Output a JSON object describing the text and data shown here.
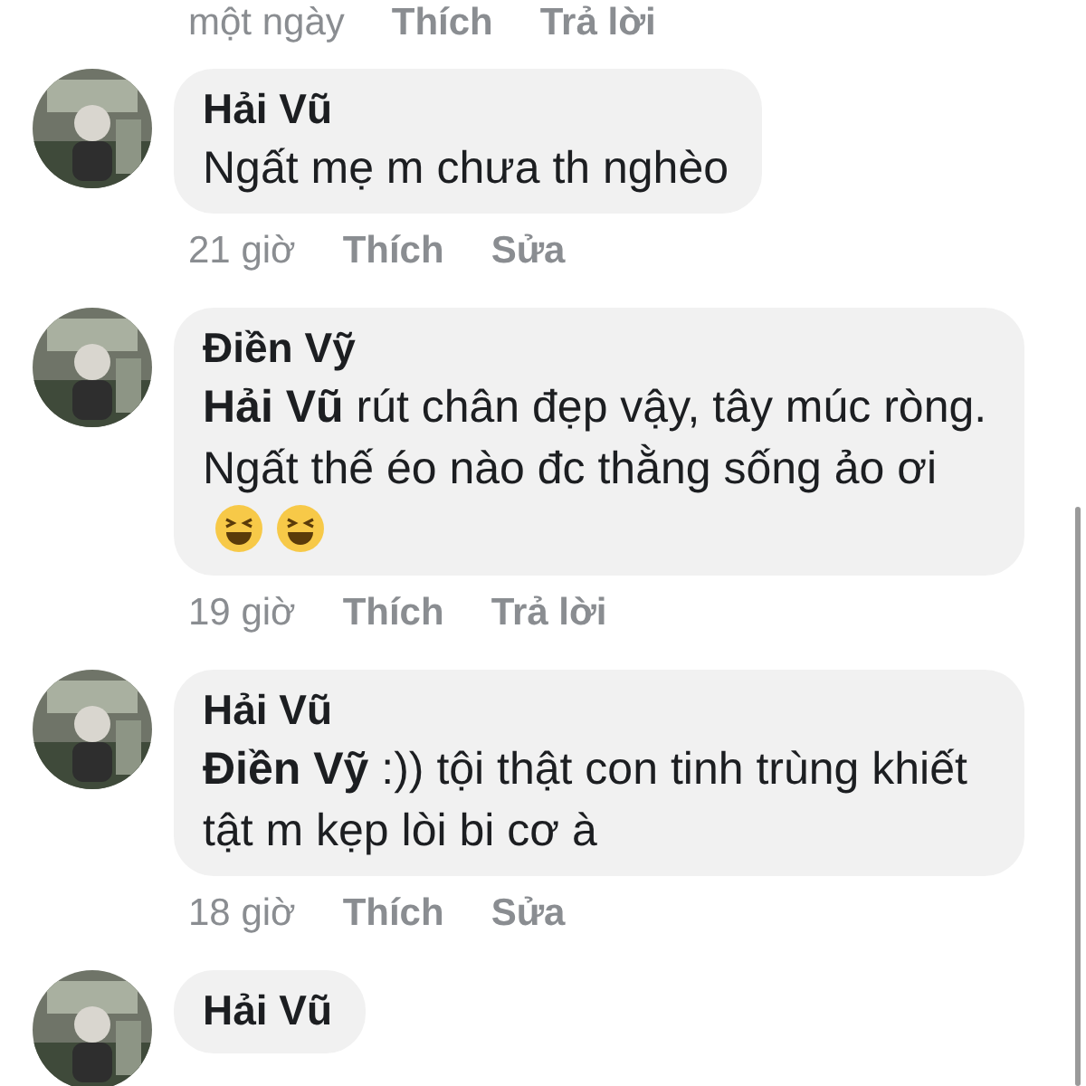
{
  "previous_comment_meta": {
    "time": "một ngày",
    "actions": [
      {
        "label": "Thích"
      },
      {
        "label": "Trả lời"
      }
    ]
  },
  "comments": [
    {
      "author": "Hải Vũ",
      "text": "Ngất mẹ m chưa th nghèo",
      "time": "21 giờ",
      "actions": [
        {
          "label": "Thích"
        },
        {
          "label": "Sửa"
        }
      ]
    },
    {
      "author": "Điền Vỹ",
      "text": "**Hải Vũ**  rút chân đẹp vậy, tây múc ròng. Ngất thế éo nào đc thằng sống ảo ơi",
      "emojis": [
        {
          "kind": "laughing-face"
        },
        {
          "kind": "laughing-face"
        }
      ],
      "time": "19 giờ",
      "actions": [
        {
          "label": "Thích"
        },
        {
          "label": "Trả lời"
        }
      ]
    },
    {
      "author": "Hải Vũ",
      "text": "**Điền Vỹ**  :)) tội thật con tinh trùng khiết tật m kẹp lòi bi cơ à",
      "time": "18 giờ",
      "actions": [
        {
          "label": "Thích"
        },
        {
          "label": "Sửa"
        }
      ]
    },
    {
      "author": "Hải Vũ"
    }
  ]
}
